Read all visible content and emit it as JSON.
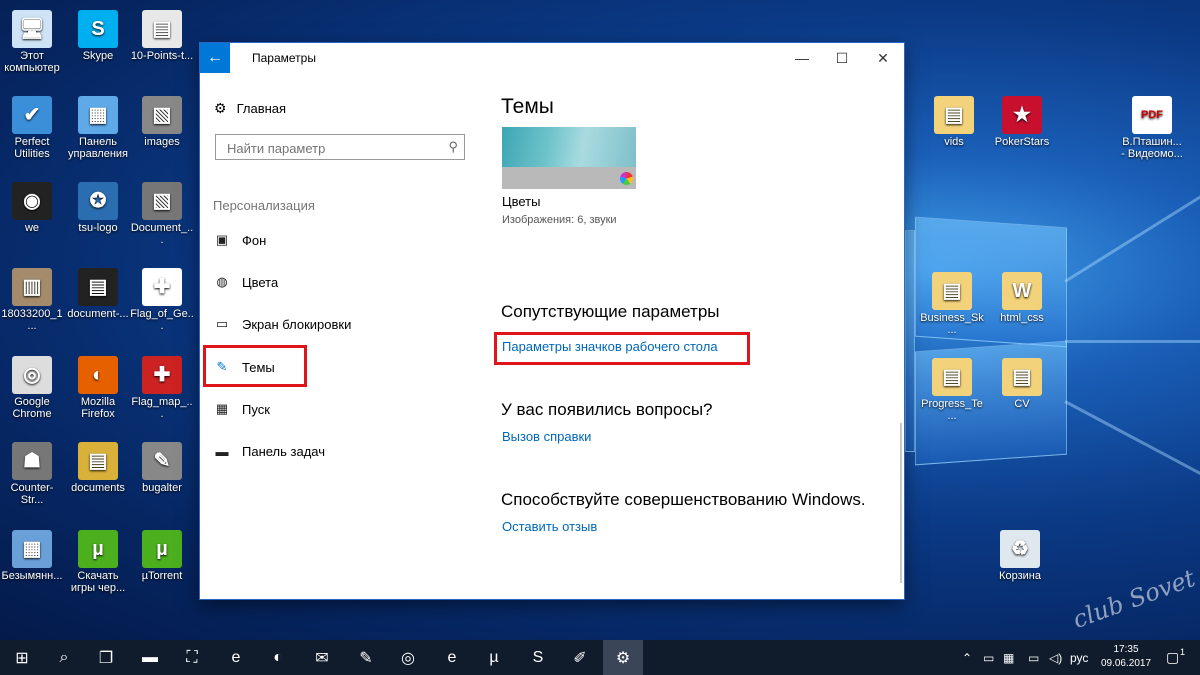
{
  "desktop_icons": [
    {
      "label": "Этот компьютер",
      "icon": "computer-icon",
      "color": "#cfe3f7",
      "glyph": "🖥"
    },
    {
      "label": "Skype",
      "icon": "skype-icon",
      "color": "#00aff0",
      "glyph": "S"
    },
    {
      "label": "10-Points-t...",
      "icon": "document-thumbnail-icon",
      "color": "#e8e8e8",
      "glyph": "▤"
    },
    {
      "label": "Perfect Utilities",
      "icon": "perfect-utilities-icon",
      "color": "#3a8fd8",
      "glyph": "✔"
    },
    {
      "label": "Панель управления",
      "icon": "control-panel-icon",
      "color": "#5fa9e8",
      "glyph": "▦"
    },
    {
      "label": "images",
      "icon": "images-folder-icon",
      "color": "#888",
      "glyph": "▧"
    },
    {
      "label": "we",
      "icon": "camera-icon",
      "color": "#222",
      "glyph": "◉"
    },
    {
      "label": "tsu-logo",
      "icon": "tsu-logo-icon",
      "color": "#2a6db0",
      "glyph": "✪"
    },
    {
      "label": "Document_...",
      "icon": "document-image-icon",
      "color": "#777",
      "glyph": "▧"
    },
    {
      "label": "18033200_1...",
      "icon": "scan-image-icon",
      "color": "#a38b6b",
      "glyph": "▥"
    },
    {
      "label": "document-...",
      "icon": "document-dark-icon",
      "color": "#222",
      "glyph": "▤"
    },
    {
      "label": "Flag_of_Ge...",
      "icon": "georgia-flag-icon",
      "color": "#fff",
      "glyph": "✚"
    },
    {
      "label": "Google Chrome",
      "icon": "chrome-icon",
      "color": "#ddd",
      "glyph": "◎"
    },
    {
      "label": "Mozilla Firefox",
      "icon": "firefox-icon",
      "color": "#e66000",
      "glyph": "◐"
    },
    {
      "label": "Flag_map_...",
      "icon": "flag-map-icon",
      "color": "#c22",
      "glyph": "✚"
    },
    {
      "label": "Counter-Str...",
      "icon": "counter-strike-icon",
      "color": "#777",
      "glyph": "☗"
    },
    {
      "label": "documents",
      "icon": "documents-stack-icon",
      "color": "#d8b03a",
      "glyph": "▤"
    },
    {
      "label": "bugalter",
      "icon": "bugalter-icon",
      "color": "#888",
      "glyph": "✎"
    },
    {
      "label": "Безымянн...",
      "icon": "untitled-image-icon",
      "color": "#6aa0d8",
      "glyph": "▦"
    },
    {
      "label": "Скачать игры чер...",
      "icon": "utorrent-shortcut-icon",
      "color": "#4caf1e",
      "glyph": "µ"
    },
    {
      "label": "µTorrent",
      "icon": "utorrent-icon",
      "color": "#4caf1e",
      "glyph": "µ"
    },
    {
      "label": "vids",
      "icon": "vids-folder-icon",
      "color": "#f2d27a",
      "glyph": "▤"
    },
    {
      "label": "PokerStars",
      "icon": "pokerstars-icon",
      "color": "#c8102e",
      "glyph": "★"
    },
    {
      "label": "В.Пташин... - Видеомо...",
      "icon": "pdf-icon",
      "color": "#fff",
      "glyph": "PDF"
    },
    {
      "label": "Business_Sk...",
      "icon": "business-folder-icon",
      "color": "#f2d27a",
      "glyph": "▤"
    },
    {
      "label": "html_css",
      "icon": "word-document-icon",
      "color": "#f2d27a",
      "glyph": "W"
    },
    {
      "label": "Progress_Te...",
      "icon": "progress-folder-icon",
      "color": "#f2d27a",
      "glyph": "▤"
    },
    {
      "label": "CV",
      "icon": "cv-pdf-icon",
      "color": "#f2d27a",
      "glyph": "▤"
    },
    {
      "label": "Корзина",
      "icon": "recycle-bin-icon",
      "color": "#dfe8ef",
      "glyph": "♻"
    }
  ],
  "window": {
    "title": "Параметры",
    "back_glyph": "←",
    "minimize_glyph": "—",
    "maximize_glyph": "☐",
    "close_glyph": "✕"
  },
  "sidebar": {
    "home_label": "Главная",
    "search_placeholder": "Найти параметр",
    "section_title": "Персонализация",
    "items": [
      {
        "label": "Фон",
        "icon": "background-picture-icon",
        "glyph": "▣"
      },
      {
        "label": "Цвета",
        "icon": "palette-icon",
        "glyph": "◍"
      },
      {
        "label": "Экран блокировки",
        "icon": "lock-screen-icon",
        "glyph": "▭"
      },
      {
        "label": "Темы",
        "icon": "themes-brush-icon",
        "glyph": "✎",
        "selected": true
      },
      {
        "label": "Пуск",
        "icon": "start-grid-icon",
        "glyph": "▦"
      },
      {
        "label": "Панель задач",
        "icon": "taskbar-icon",
        "glyph": "▬"
      }
    ]
  },
  "main": {
    "themes_heading": "Темы",
    "theme_name": "Цветы",
    "theme_meta": "Изображения: 6, звуки",
    "related_heading": "Сопутствующие параметры",
    "related_link": "Параметры значков рабочего стола",
    "questions_heading": "У вас появились вопросы?",
    "help_link": "Вызов справки",
    "improve_heading": "Способствуйте совершенствованию Windows.",
    "feedback_link": "Оставить отзыв"
  },
  "taskbar": {
    "apps": [
      {
        "name": "start-button",
        "glyph": "⊞"
      },
      {
        "name": "search-button",
        "glyph": "⌕"
      },
      {
        "name": "task-view-button",
        "glyph": "❐"
      },
      {
        "name": "file-explorer-button",
        "glyph": "▬"
      },
      {
        "name": "store-button",
        "glyph": "⛶"
      },
      {
        "name": "edge-button",
        "glyph": "e"
      },
      {
        "name": "firefox-taskbar-button",
        "glyph": "◐"
      },
      {
        "name": "mail-button",
        "glyph": "✉"
      },
      {
        "name": "app-button",
        "glyph": "✎"
      },
      {
        "name": "chrome-taskbar-button",
        "glyph": "◎"
      },
      {
        "name": "uc-browser-button",
        "glyph": "e"
      },
      {
        "name": "utorrent-taskbar-button",
        "glyph": "µ"
      },
      {
        "name": "skype-taskbar-button",
        "glyph": "S"
      },
      {
        "name": "paint-button",
        "glyph": "✐"
      },
      {
        "name": "settings-taskbar-button",
        "glyph": "⚙"
      }
    ],
    "lang": "рус",
    "time": "17:35",
    "date": "09.06.2017",
    "notification_count": "1"
  },
  "watermark": "club Sovet",
  "colors": {
    "accent": "#0078d7",
    "link": "#0067b8",
    "highlight": "#e0151b"
  }
}
